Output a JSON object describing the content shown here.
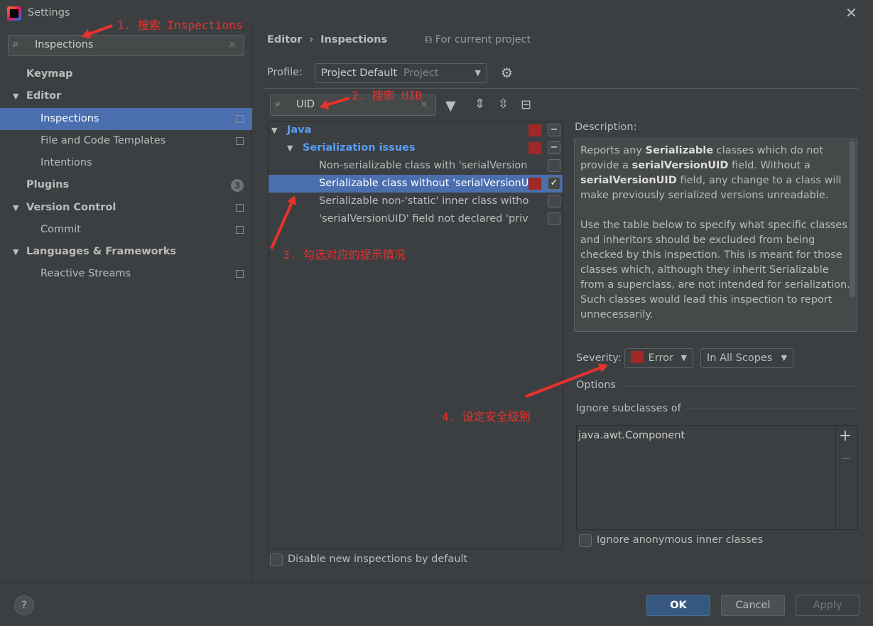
{
  "window": {
    "title": "Settings",
    "close_icon": "close-icon"
  },
  "sidebar": {
    "search_value": "Inspections",
    "items": [
      {
        "label": "Keymap"
      },
      {
        "label": "Editor"
      },
      {
        "label": "Inspections"
      },
      {
        "label": "File and Code Templates"
      },
      {
        "label": "Intentions"
      },
      {
        "label": "Plugins",
        "badge": "3"
      },
      {
        "label": "Version Control"
      },
      {
        "label": "Commit"
      },
      {
        "label": "Languages & Frameworks"
      },
      {
        "label": "Reactive Streams"
      }
    ]
  },
  "breadcrumb": {
    "parent": "Editor",
    "current": "Inspections",
    "scope": "For current project"
  },
  "profile": {
    "label": "Profile:",
    "value": "Project Default",
    "hint": "Project"
  },
  "filter": {
    "search_value": "UID"
  },
  "tree": {
    "rows": [
      {
        "label": "Java"
      },
      {
        "label": "Serialization issues"
      },
      {
        "label": "Non-serializable class with 'serialVersion"
      },
      {
        "label": "Serializable class without 'serialVersionU"
      },
      {
        "label": "Serializable non-'static' inner class witho"
      },
      {
        "label": "'serialVersionUID' field not declared 'priv"
      }
    ],
    "disable_new": "Disable new inspections by default"
  },
  "description": {
    "label": "Description:",
    "p1": [
      "Reports any ",
      "Serializable",
      " classes which do not provide a ",
      "serialVersionUID",
      " field. Without a ",
      "serialVersionUID",
      " field, any change to a class will make previously serialized versions unreadable."
    ],
    "p2": "Use the table below to specify what specific classes and inheritors should be excluded from being checked by this inspection. This is meant for those classes which, although they inherit Serializable from a superclass, are not intended for serialization. Such classes would lead this inspection to report unnecessarily."
  },
  "severity": {
    "label": "Severity:",
    "value": "Error",
    "scope": "In All Scopes",
    "color": "#9e2927"
  },
  "options": {
    "label": "Options",
    "ignore_label": "Ignore subclasses of",
    "items": [
      "java.awt.Component"
    ],
    "add": "+",
    "remove": "−",
    "anon": "Ignore anonymous inner classes"
  },
  "footer": {
    "help": "?",
    "ok": "OK",
    "cancel": "Cancel",
    "apply": "Apply"
  },
  "annotations": [
    "1. 搜索 Inspections",
    "2. 搜索 UID",
    "3. 勾选对应的提示情况",
    "4. 设定安全级别"
  ],
  "colors": {
    "accent": "#4b6eaf",
    "annotation": "#e8322e",
    "link": "#589df6"
  }
}
